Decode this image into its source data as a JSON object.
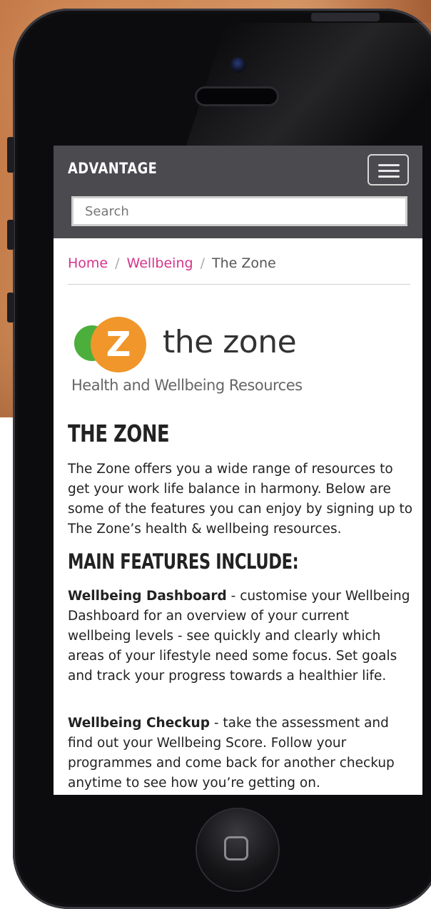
{
  "navbar": {
    "brand": "ADVANTAGE",
    "search_placeholder": "Search"
  },
  "breadcrumb": {
    "items": [
      "Home",
      "Wellbeing",
      "The Zone"
    ]
  },
  "logo": {
    "letter": "Z",
    "name": "the zone",
    "tagline": "Health and Wellbeing Resources"
  },
  "content": {
    "title": "THE ZONE",
    "intro": "The Zone offers you a wide range of resources to get your work life balance in harmony. Below are some of the features you can enjoy by signing up to The Zone’s health & wellbeing resources.",
    "features_heading": "MAIN FEATURES INCLUDE:",
    "features": [
      {
        "name": "Wellbeing Dashboard",
        "text": " - customise your Wellbeing Dashboard for an overview of your current wellbeing levels - see quickly and clearly which areas of your lifestyle need some focus. Set goals and track your progress towards a healthier life."
      },
      {
        "name": "Wellbeing Checkup",
        "text": " - take the assessment and find out your Wellbeing Score. Follow your programmes and come back for another checkup anytime to see how you’re getting on."
      }
    ]
  },
  "colors": {
    "navbar": "#4a4a4f",
    "link": "#d6338a",
    "logo_green": "#4caf3c",
    "logo_orange": "#f0962a"
  },
  "icons": {
    "menu": "hamburger-icon",
    "home_button": "home-square-icon"
  }
}
